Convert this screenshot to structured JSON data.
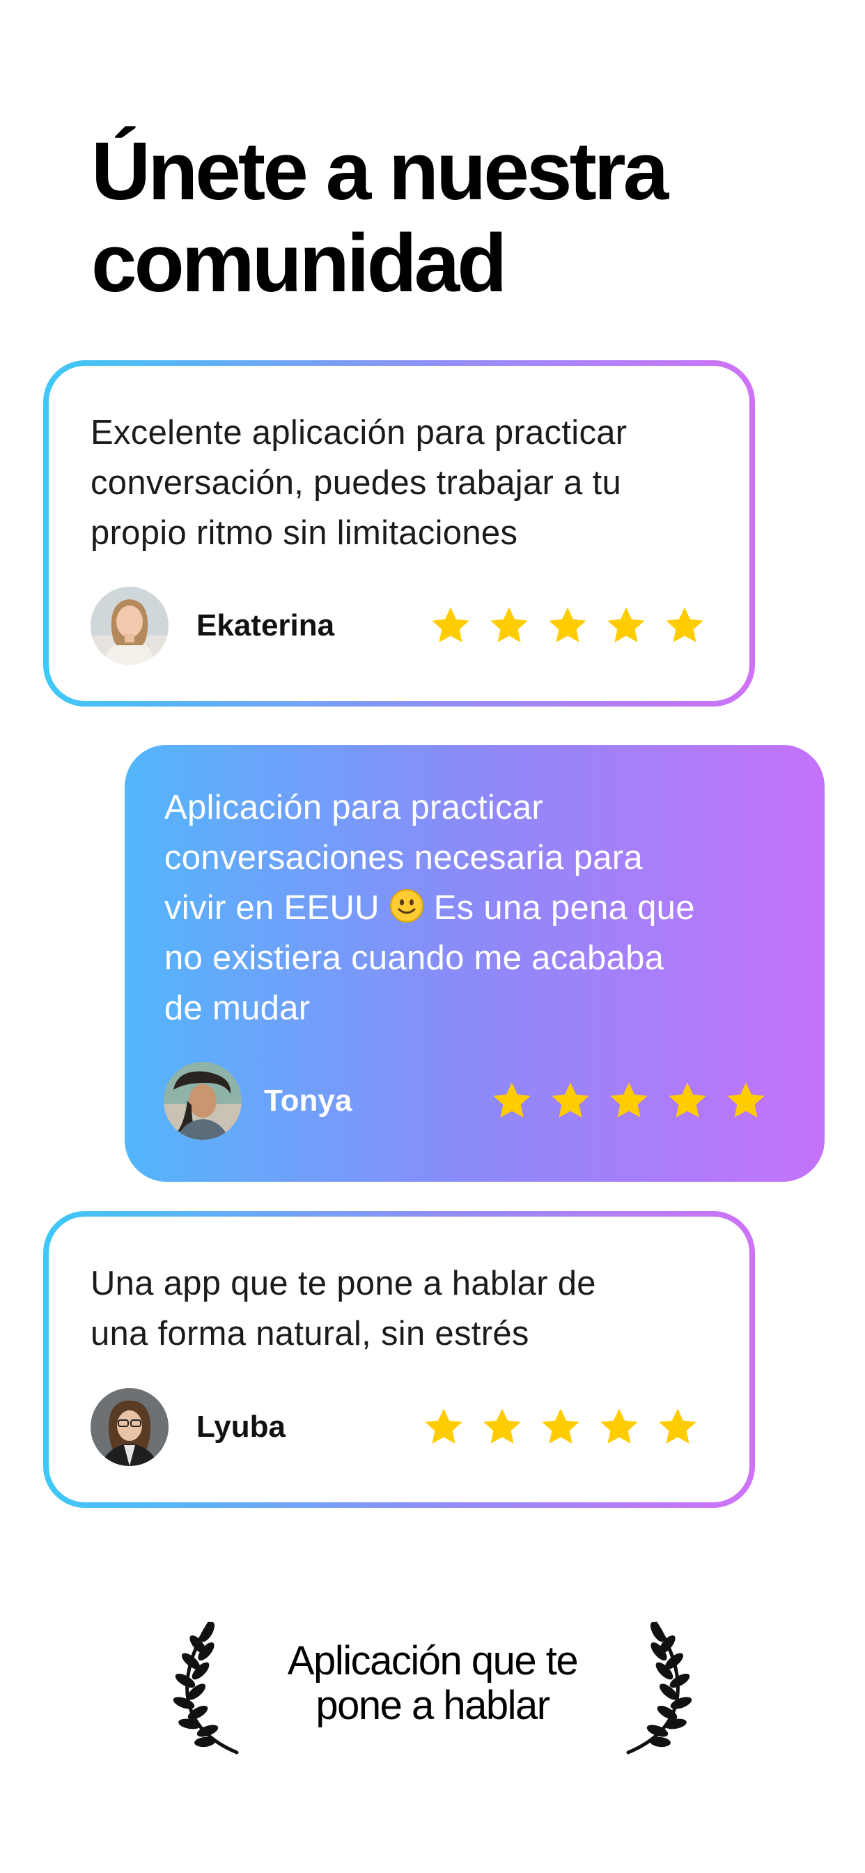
{
  "header": {
    "title_line1": "Únete a nuestra",
    "title_line2": "comunidad"
  },
  "reviews": [
    {
      "lines": [
        "Excelente aplicación para practicar",
        "conversación, puedes trabajar a tu",
        "propio ritmo sin limitaciones"
      ],
      "name": "Ekaterina",
      "rating": 5,
      "style": "outline"
    },
    {
      "lines": [
        "Aplicación para practicar",
        "conversaciones necesaria para",
        "vivir en EEUU",
        "Es una pena que",
        "no existiera cuando me acababa",
        "de mudar"
      ],
      "name": "Tonya",
      "rating": 5,
      "style": "filled"
    },
    {
      "lines": [
        "Una app que te pone a hablar de",
        "una forma natural, sin estrés"
      ],
      "name": "Lyuba",
      "rating": 5,
      "style": "outline"
    }
  ],
  "award": {
    "line1": "Aplicación que te",
    "line2": "pone a hablar"
  },
  "colors": {
    "gradient_start": "#3dc8f7",
    "gradient_end": "#cf72f7",
    "star": "#ffcc00"
  },
  "icons": {
    "star": "star-icon",
    "emoji": "slightly-smiling-face-icon",
    "laurel": "laurel-wreath-icon"
  }
}
